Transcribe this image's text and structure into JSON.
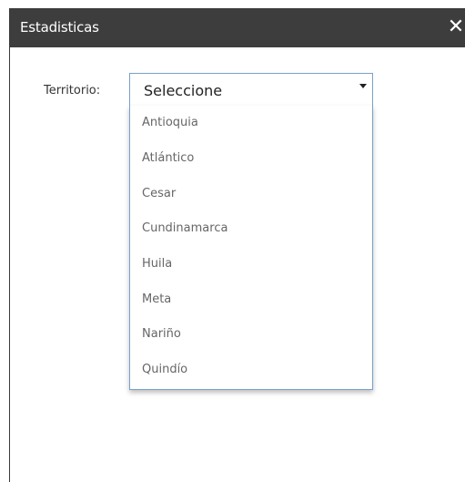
{
  "dialog": {
    "title": "Estadisticas",
    "close_label": "✕"
  },
  "form": {
    "territory_label": "Territorio:",
    "territory_select": {
      "selected": "Seleccione",
      "options": [
        "Antioquia",
        "Atlántico",
        "Cesar",
        "Cundinamarca",
        "Huila",
        "Meta",
        "Nariño",
        "Quindío"
      ]
    }
  }
}
